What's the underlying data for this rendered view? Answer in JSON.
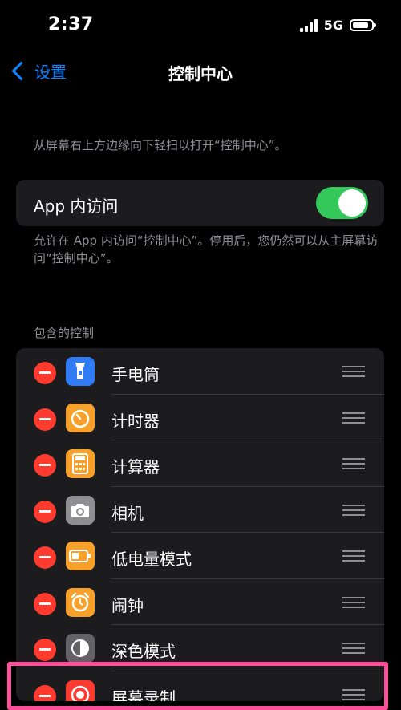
{
  "status": {
    "time": "2:37",
    "network": "5G"
  },
  "nav": {
    "back_label": "设置",
    "title": "控制中心"
  },
  "intro": "从屏幕右上方边缘向下轻扫以打开“控制中心”。",
  "app_access": {
    "label": "App 内访问",
    "enabled": true,
    "description": "允许在 App 内访问“控制中心”。停用后，您仍然可以从主屏幕访问“控制中心”。"
  },
  "included_header": "包含的控制",
  "controls": [
    {
      "label": "手电筒",
      "icon": "flashlight-icon",
      "color": "#2f7cf6"
    },
    {
      "label": "计时器",
      "icon": "timer-icon",
      "color": "#f7a12a"
    },
    {
      "label": "计算器",
      "icon": "calculator-icon",
      "color": "#f7a12a"
    },
    {
      "label": "相机",
      "icon": "camera-icon",
      "color": "#8e8e93"
    },
    {
      "label": "低电量模式",
      "icon": "battery-icon",
      "color": "#f7a12a"
    },
    {
      "label": "闹钟",
      "icon": "alarm-icon",
      "color": "#f7a12a"
    },
    {
      "label": "深色模式",
      "icon": "dark-mode-icon",
      "color": "#636366"
    },
    {
      "label": "屏幕录制",
      "icon": "record-icon",
      "color": "#ff3b30"
    }
  ],
  "colors": {
    "accent": "#0a84ff",
    "toggle_on": "#34c759",
    "highlight": "#ff4f9a",
    "remove": "#ff3b30"
  }
}
